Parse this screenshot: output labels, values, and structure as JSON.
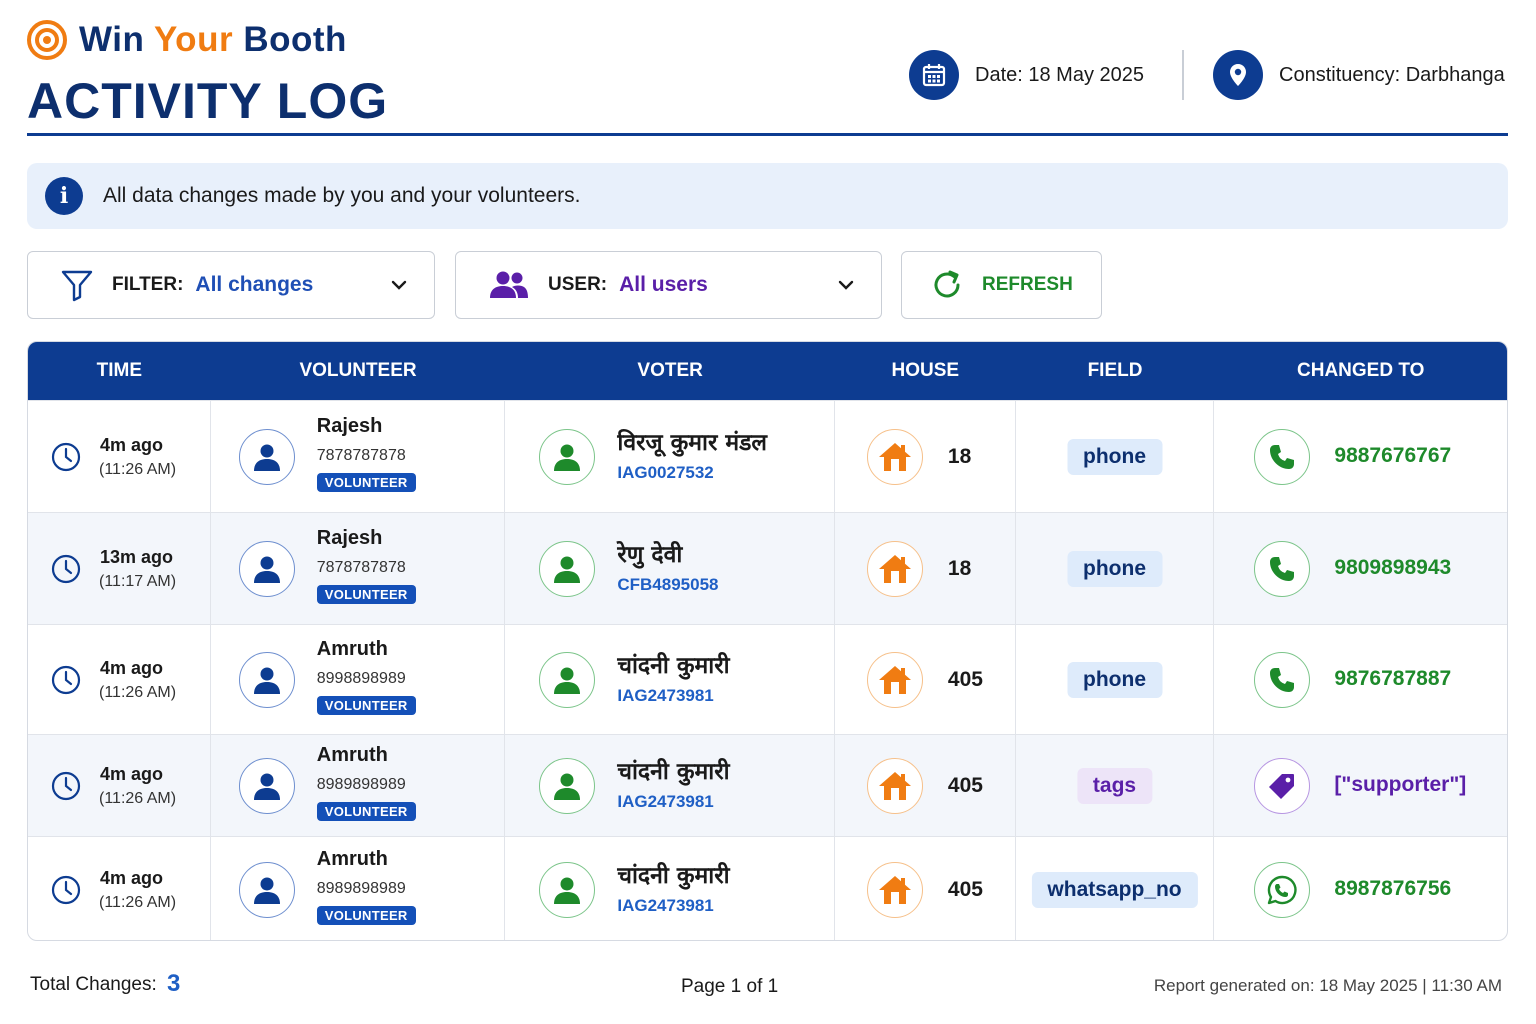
{
  "brand": {
    "part1": "Win",
    "part2": "Your",
    "part3": "Booth"
  },
  "page_title": "ACTIVITY LOG",
  "meta": {
    "date_label": "Date: 18 May 2025",
    "constituency_label": "Constituency: Darbhanga"
  },
  "info": {
    "text": "All data changes made by you and your volunteers."
  },
  "controls": {
    "filter_label": "FILTER:",
    "filter_value": "All changes",
    "user_label": "USER:",
    "user_value": "All users",
    "refresh_label": "REFRESH"
  },
  "table": {
    "headers": [
      "TIME",
      "VOLUNTEER",
      "VOTER",
      "HOUSE",
      "FIELD",
      "CHANGED TO"
    ],
    "rows": [
      {
        "time": "4m ago",
        "time_sub": "(11:26 AM)",
        "vol_name": "Rajesh",
        "vol_phone": "7878787878",
        "vol_badge": "VOLUNTEER",
        "voter_name": "विरजू कुमार मंडल",
        "voter_id": "IAG0027532",
        "house": "18",
        "field": "phone",
        "changed_to": "9887676767",
        "change_icon": "phone-icon"
      },
      {
        "time": "13m ago",
        "time_sub": "(11:17 AM)",
        "vol_name": "Rajesh",
        "vol_phone": "7878787878",
        "vol_badge": "VOLUNTEER",
        "voter_name": "रेणु देवी",
        "voter_id": "CFB4895058",
        "house": "18",
        "field": "phone",
        "changed_to": "9809898943",
        "change_icon": "phone-icon"
      },
      {
        "time": "4m ago",
        "time_sub": "(11:26 AM)",
        "vol_name": "Amruth",
        "vol_phone": "8998898989",
        "vol_badge": "VOLUNTEER",
        "voter_name": "चांदनी कुमारी",
        "voter_id": "IAG2473981",
        "house": "405",
        "field": "phone",
        "changed_to": "9876787887",
        "change_icon": "phone-icon"
      },
      {
        "time": "4m ago",
        "time_sub": "(11:26 AM)",
        "vol_name": "Amruth",
        "vol_phone": "8989898989",
        "vol_badge": "VOLUNTEER",
        "voter_name": "चांदनी कुमारी",
        "voter_id": "IAG2473981",
        "house": "405",
        "field": "tags",
        "changed_to": "[\"supporter\"]",
        "change_icon": "tag-icon"
      },
      {
        "time": "4m ago",
        "time_sub": "(11:26 AM)",
        "vol_name": "Amruth",
        "vol_phone": "8989898989",
        "vol_badge": "VOLUNTEER",
        "voter_name": "चांदनी कुमारी",
        "voter_id": "IAG2473981",
        "house": "405",
        "field": "whatsapp_no",
        "changed_to": "8987876756",
        "change_icon": "whatsapp-icon"
      }
    ]
  },
  "footer": {
    "total_label": "Total Changes:",
    "total_value": "3",
    "page_info": "Page 1 of 1",
    "generated": "Report generated on: 18 May 2025  |  11:30 AM"
  },
  "colors": {
    "primary": "#0d3c91",
    "accent_orange": "#f07c12",
    "success_green": "#1e8a2b",
    "tag_purple": "#5a1fa8"
  }
}
